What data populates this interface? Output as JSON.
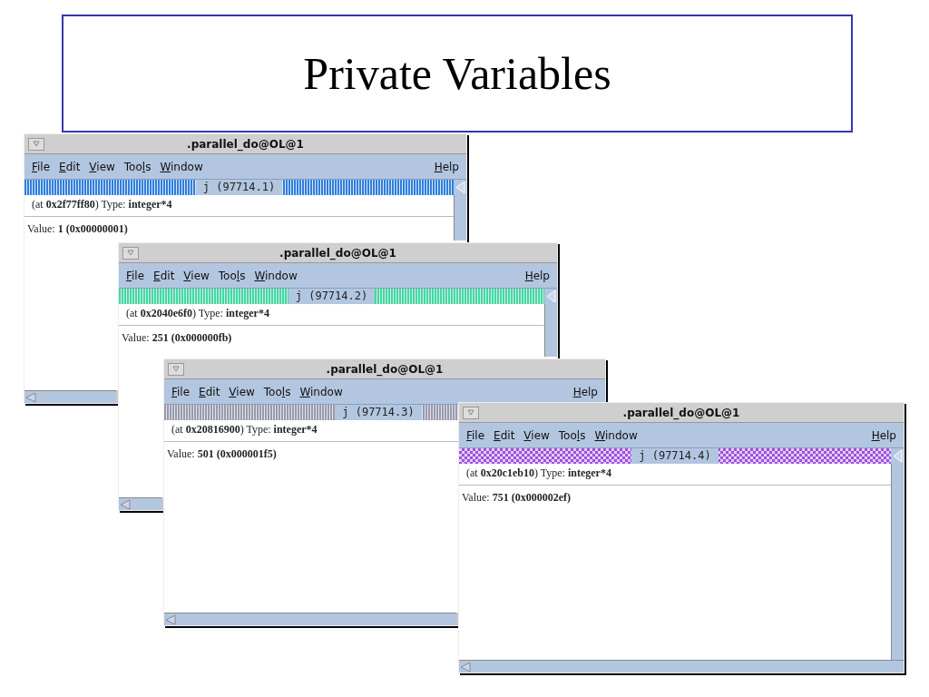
{
  "slide": {
    "title": "Private Variables"
  },
  "windows": [
    {
      "title": ".parallel_do@OL@1",
      "menu": [
        {
          "key": "F",
          "rest": "ile"
        },
        {
          "key": "E",
          "rest": "dit"
        },
        {
          "key": "V",
          "rest": "iew"
        },
        {
          "lead": "Too",
          "key": "l",
          "rest": "s"
        },
        {
          "key": "W",
          "rest": "indow"
        }
      ],
      "help": {
        "key": "H",
        "rest": "elp"
      },
      "thread": {
        "label": "j (97714.1)",
        "kind": "stripes",
        "color": "#2f7fe0"
      },
      "info": "(at **0x2f77ff80**) Type: **integer*4**",
      "value": "Value: **1 (0x00000001)**"
    },
    {
      "title": ".parallel_do@OL@1",
      "menu": [
        {
          "key": "F",
          "rest": "ile"
        },
        {
          "key": "E",
          "rest": "dit"
        },
        {
          "key": "V",
          "rest": "iew"
        },
        {
          "lead": "Too",
          "key": "l",
          "rest": "s"
        },
        {
          "key": "W",
          "rest": "indow"
        }
      ],
      "help": {
        "key": "H",
        "rest": "elp"
      },
      "thread": {
        "label": "j (97714.2)",
        "kind": "stripes",
        "color": "#3ddc9c"
      },
      "info": "(at **0x2040e6f0**) Type: **integer*4**",
      "value": "Value: **251 (0x000000fb)**"
    },
    {
      "title": ".parallel_do@OL@1",
      "menu": [
        {
          "key": "F",
          "rest": "ile"
        },
        {
          "key": "E",
          "rest": "dit"
        },
        {
          "key": "V",
          "rest": "iew"
        },
        {
          "lead": "Too",
          "key": "l",
          "rest": "s"
        },
        {
          "key": "W",
          "rest": "indow"
        }
      ],
      "help": {
        "key": "H",
        "rest": "elp"
      },
      "thread": {
        "label": "j (97714.3)",
        "kind": "stripes",
        "color": "#9a9aa8"
      },
      "info": "(at **0x20816900**) Type: **integer*4**",
      "value": "Value: **501 (0x000001f5)**"
    },
    {
      "title": ".parallel_do@OL@1",
      "menu": [
        {
          "key": "F",
          "rest": "ile"
        },
        {
          "key": "E",
          "rest": "dit"
        },
        {
          "key": "V",
          "rest": "iew"
        },
        {
          "lead": "Too",
          "key": "l",
          "rest": "s"
        },
        {
          "key": "W",
          "rest": "indow"
        }
      ],
      "help": {
        "key": "H",
        "rest": "elp"
      },
      "thread": {
        "label": "j (97714.4)",
        "kind": "checker",
        "color": "#a04ee0"
      },
      "info": "(at **0x20c1eb10**) Type: **integer*4**",
      "value": "Value: **751 (0x000002ef)**"
    }
  ]
}
